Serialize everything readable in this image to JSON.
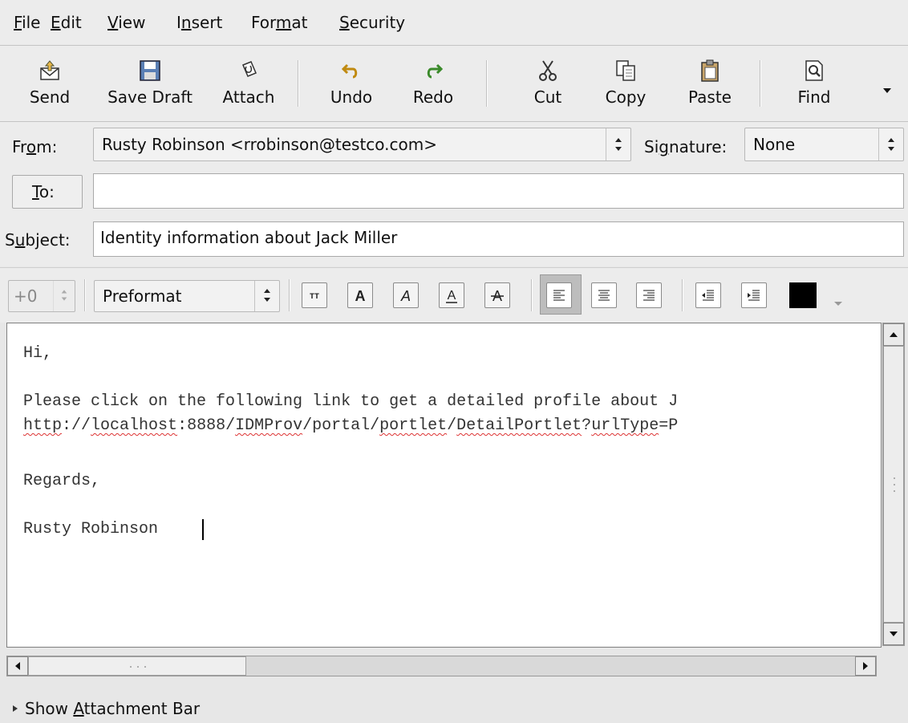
{
  "menu": {
    "items": [
      {
        "label_pre": "",
        "label_ul": "F",
        "label_post": "ile"
      },
      {
        "label_pre": "",
        "label_ul": "E",
        "label_post": "dit"
      },
      {
        "label_pre": "",
        "label_ul": "V",
        "label_post": "iew"
      },
      {
        "label_pre": "I",
        "label_ul": "n",
        "label_post": "sert"
      },
      {
        "label_pre": "For",
        "label_ul": "m",
        "label_post": "at"
      },
      {
        "label_pre": "",
        "label_ul": "S",
        "label_post": "ecurity"
      }
    ]
  },
  "toolbar": {
    "send": "Send",
    "save_draft": "Save Draft",
    "attach": "Attach",
    "undo": "Undo",
    "redo": "Redo",
    "cut": "Cut",
    "copy": "Copy",
    "paste": "Paste",
    "find": "Find"
  },
  "address": {
    "from_label_pre": "Fr",
    "from_label_ul": "o",
    "from_label_post": "m:",
    "from_value": "Rusty Robinson <rrobinson@testco.com>",
    "signature_label_pre": "Si",
    "signature_label_ul": "g",
    "signature_label_post": "nature:",
    "signature_value": "None",
    "to_label_ul": "T",
    "to_label_post": "o:",
    "to_value": "",
    "subject_label_pre": "S",
    "subject_label_ul": "u",
    "subject_label_post": "bject:",
    "subject_value": "Identity information about Jack Miller"
  },
  "format": {
    "font_size": "+0",
    "paragraph_style": "Preformat",
    "text_color": "#000000"
  },
  "body": {
    "greeting": "Hi,",
    "line1": "Please click on the following link to get a detailed profile about J",
    "link": {
      "p1": "http",
      "p2": "://",
      "p3": "localhost",
      "p4": ":8888/",
      "p5": "IDMProv",
      "p6": "/portal/",
      "p7": "portlet",
      "p8": "/",
      "p9": "DetailPortlet",
      "p10": "?",
      "p11": "urlType",
      "p12": "=P"
    },
    "regards": "Regards,",
    "signature": "Rusty Robinson"
  },
  "attachment_bar": {
    "label_pre": "Show ",
    "label_ul": "A",
    "label_post": "ttachment Bar"
  }
}
